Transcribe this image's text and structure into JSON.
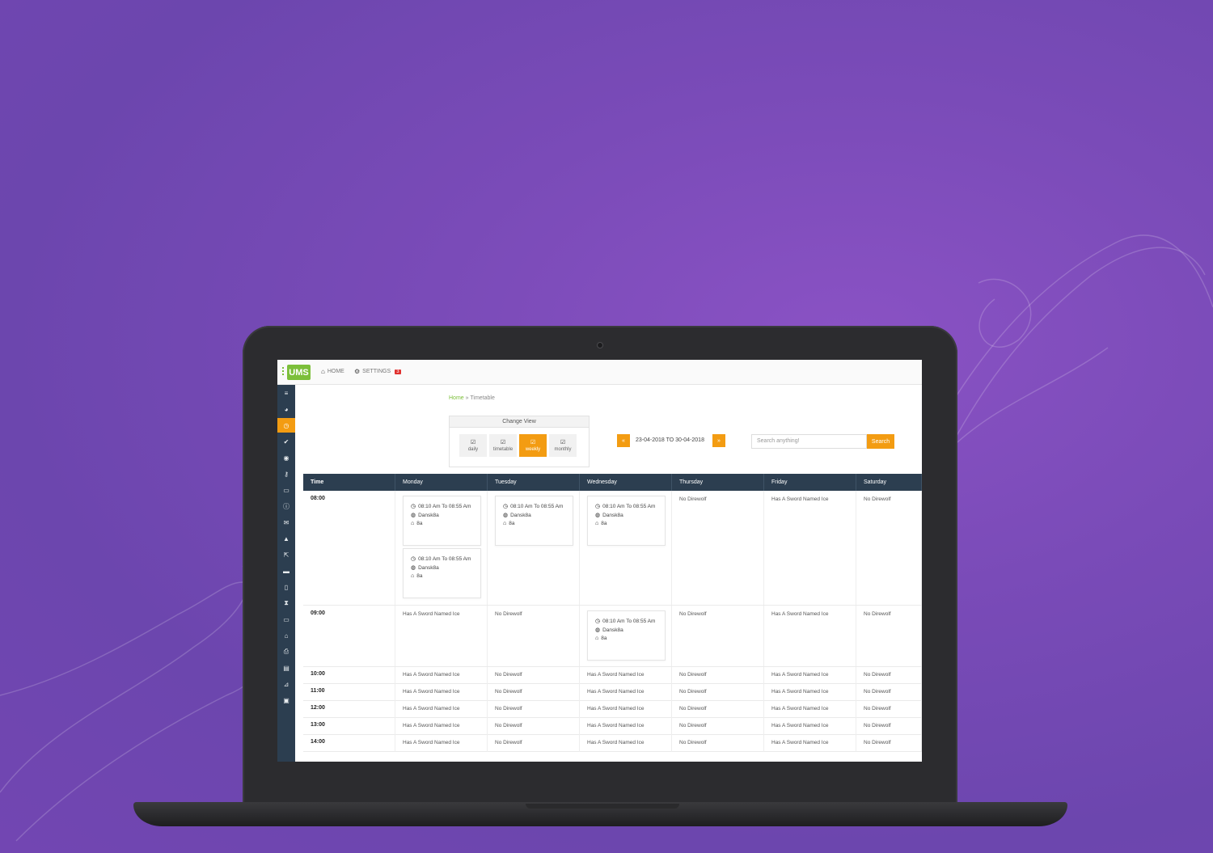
{
  "app": {
    "logo": "UMS"
  },
  "topnav": [
    {
      "label": "HOME",
      "icon": "home-icon"
    },
    {
      "label": "SETTINGS",
      "icon": "gears-icon",
      "badge": "3"
    }
  ],
  "sidebar": {
    "items": [
      "menu-icon",
      "dashboard-icon",
      "clock-icon",
      "check-icon",
      "circle-icon",
      "key-icon",
      "chat-icon",
      "info-icon",
      "mail-icon",
      "warning-icon",
      "share-icon",
      "card-icon",
      "mobile-icon",
      "hourglass-icon",
      "comments-icon",
      "bank-icon",
      "print-icon",
      "file-icon",
      "chart-icon",
      "inbox-icon"
    ],
    "active_index": 2
  },
  "breadcrumb": {
    "home": "Home",
    "separator": "»",
    "current": "Timetable"
  },
  "change_view": {
    "title": "Change View",
    "options": [
      "daily",
      "timetable",
      "weekly",
      "monthly"
    ],
    "active": "weekly"
  },
  "date_nav": {
    "prev": "«",
    "range": "23-04-2018 TO 30-04-2018",
    "next": "»"
  },
  "search": {
    "placeholder": "Search anything!",
    "button": "Search"
  },
  "table": {
    "headers": [
      "Time",
      "Monday",
      "Tuesday",
      "Wednesday",
      "Thursday",
      "Friday",
      "Saturday"
    ],
    "session": {
      "time": "08:10 Am To 08:55 Am",
      "teacher": "Dansk8a",
      "room": "8a"
    },
    "rows": [
      {
        "time": "08:00",
        "cells": [
          [
            "card",
            "card"
          ],
          [
            "card"
          ],
          [
            "card"
          ],
          "No Direwolf",
          "Has A Sword Named Ice",
          "No Direwolf"
        ]
      },
      {
        "time": "09:00",
        "cells": [
          "Has A Sword Named Ice",
          "No Direwolf",
          [
            "card"
          ],
          "No Direwolf",
          "Has A Sword Named Ice",
          "No Direwolf"
        ]
      },
      {
        "time": "10:00",
        "cells": [
          "Has A Sword Named Ice",
          "No Direwolf",
          "Has A Sword Named Ice",
          "No Direwolf",
          "Has A Sword Named Ice",
          "No Direwolf"
        ]
      },
      {
        "time": "11:00",
        "cells": [
          "Has A Sword Named Ice",
          "No Direwolf",
          "Has A Sword Named Ice",
          "No Direwolf",
          "Has A Sword Named Ice",
          "No Direwolf"
        ]
      },
      {
        "time": "12:00",
        "cells": [
          "Has A Sword Named Ice",
          "No Direwolf",
          "Has A Sword Named Ice",
          "No Direwolf",
          "Has A Sword Named Ice",
          "No Direwolf"
        ]
      },
      {
        "time": "13:00",
        "cells": [
          "Has A Sword Named Ice",
          "No Direwolf",
          "Has A Sword Named Ice",
          "No Direwolf",
          "Has A Sword Named Ice",
          "No Direwolf"
        ]
      },
      {
        "time": "14:00",
        "cells": [
          "Has A Sword Named Ice",
          "No Direwolf",
          "Has A Sword Named Ice",
          "No Direwolf",
          "Has A Sword Named Ice",
          "No Direwolf"
        ]
      }
    ]
  },
  "colors": {
    "accent": "#f39c12",
    "sidebar": "#2c3e50",
    "brand": "#7cbf3a",
    "background": "#7a4bb8"
  }
}
